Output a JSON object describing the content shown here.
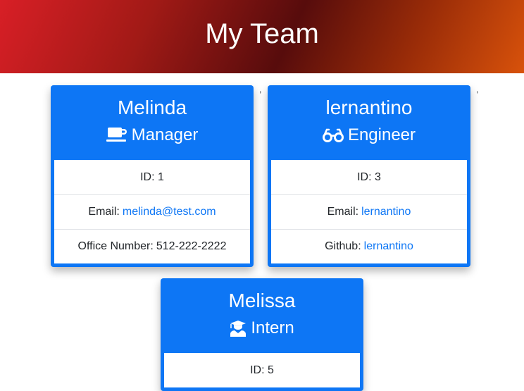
{
  "page": {
    "title": "My Team"
  },
  "separators": [
    ",",
    ","
  ],
  "cards": [
    {
      "name": "Melinda",
      "role": "Manager",
      "role_icon": "coffee-mug-icon",
      "id_text": "ID: 1",
      "email_label": "Email:",
      "email": "melinda@test.com",
      "extra_label": "Office Number:",
      "extra_value": "512-222-2222"
    },
    {
      "name": "lernantino",
      "role": "Engineer",
      "role_icon": "glasses-icon",
      "id_text": "ID: 3",
      "email_label": "Email:",
      "email": "lernantino",
      "extra_label": "Github:",
      "extra_value": "lernantino"
    },
    {
      "name": "Melissa",
      "role": "Intern",
      "role_icon": "graduate-icon",
      "id_text": "ID: 5"
    }
  ],
  "colors": {
    "card_blue": "#0d76f5",
    "link_blue": "#0d76f5",
    "banner_left": "#d81f26",
    "banner_mid": "#570c0c",
    "banner_right": "#d8520b"
  }
}
